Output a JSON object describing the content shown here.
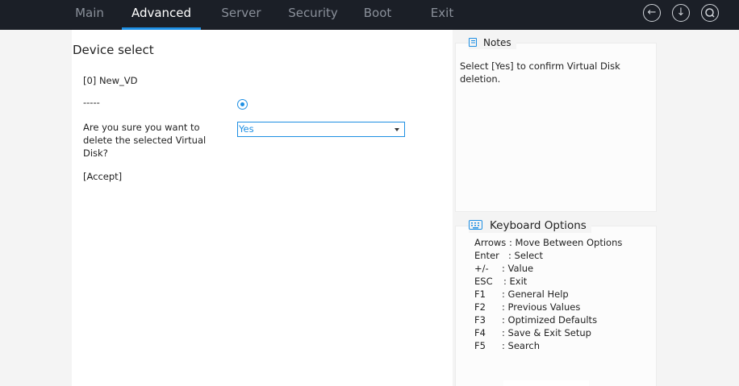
{
  "menu": {
    "tabs": [
      {
        "label": "Main",
        "active": false
      },
      {
        "label": "Advanced",
        "active": true
      },
      {
        "label": "Server",
        "active": false
      },
      {
        "label": "Security",
        "active": false
      },
      {
        "label": "Boot",
        "active": false
      },
      {
        "label": "Exit",
        "active": false
      }
    ],
    "icons": [
      "back-icon",
      "download-icon",
      "search-icon"
    ]
  },
  "main": {
    "title": "Device select",
    "device": "[0] New_VD",
    "separator": "-----",
    "question": "Are you sure you want to delete the selected Virtual Disk?",
    "select_value": "Yes",
    "accept": "[Accept]"
  },
  "notes": {
    "heading": "Notes",
    "text": "Select [Yes] to confirm Virtual Disk deletion."
  },
  "keyboard": {
    "heading": "Keyboard Options",
    "options": [
      {
        "key": "Arrows",
        "desc": ": Move Between Options"
      },
      {
        "key": "Enter",
        "desc": ": Select"
      },
      {
        "key": "+/-",
        "desc": ": Value"
      },
      {
        "key": "ESC",
        "desc": ": Exit"
      },
      {
        "key": "F1",
        "desc": ": General Help"
      },
      {
        "key": "F2",
        "desc": ": Previous Values"
      },
      {
        "key": "F3",
        "desc": ": Optimized Defaults"
      },
      {
        "key": "F4",
        "desc": ": Save & Exit Setup"
      },
      {
        "key": "F5",
        "desc": ": Search"
      }
    ]
  },
  "colors": {
    "accent": "#1e8fe3",
    "topbar": "#1b1f27",
    "background": "#f4f4f4"
  }
}
